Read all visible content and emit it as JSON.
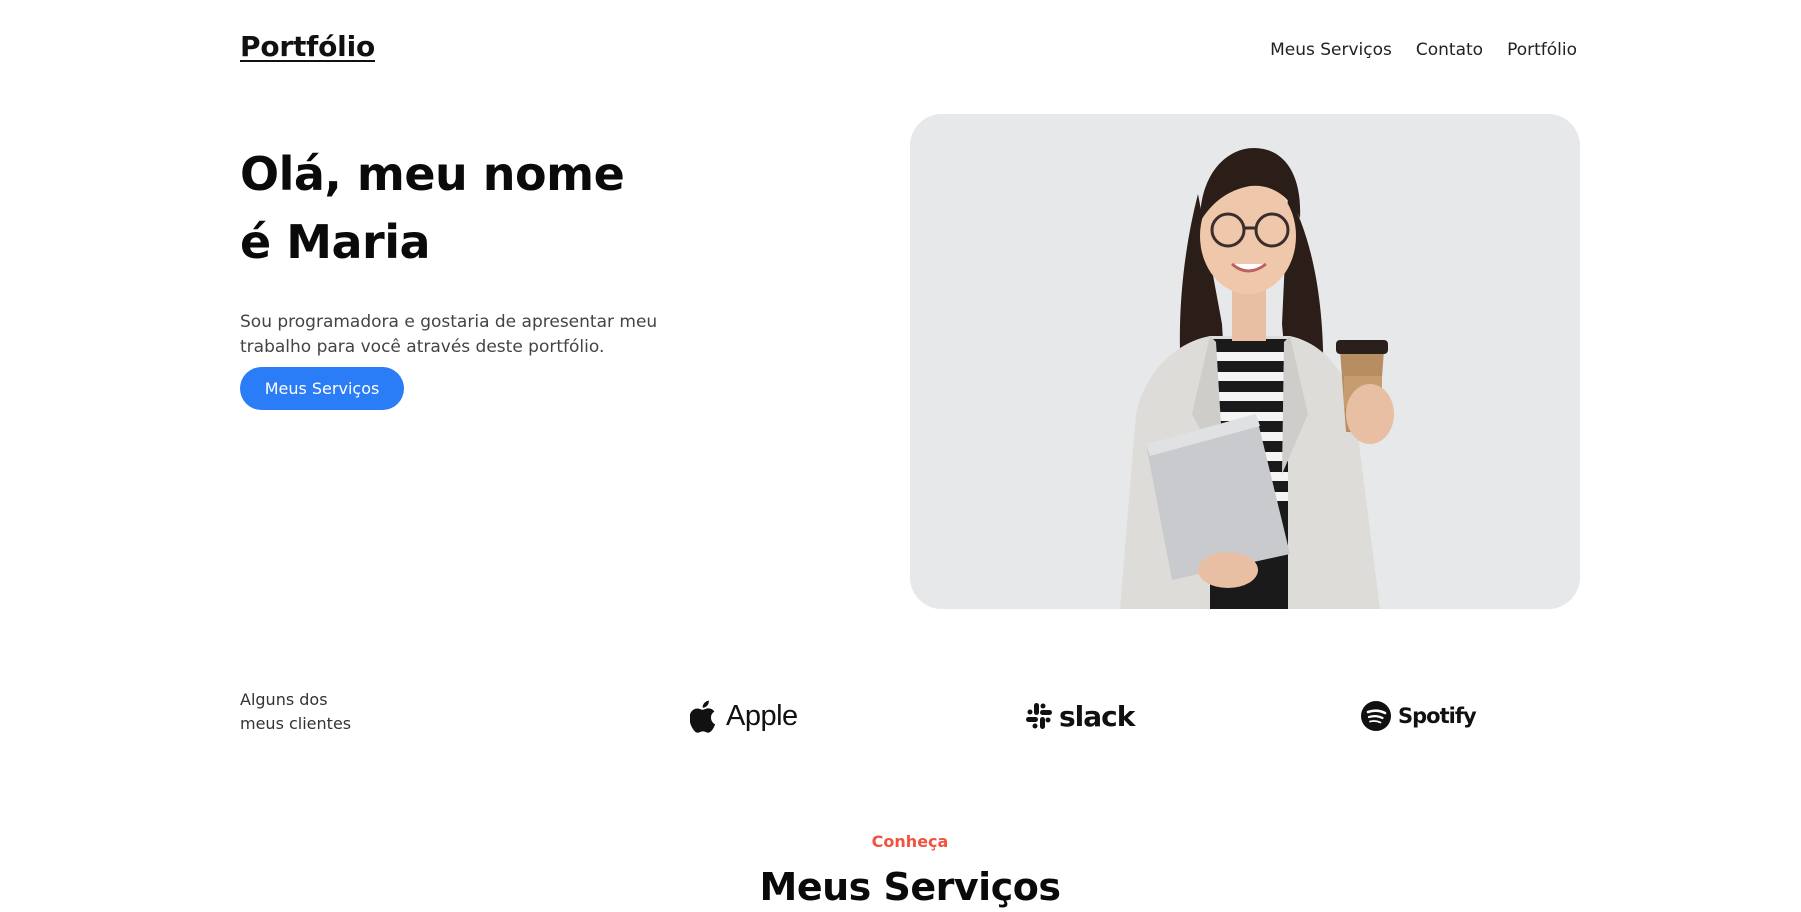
{
  "header": {
    "logo": "Portfólio",
    "nav": [
      "Meus Serviços",
      "Contato",
      "Portfólio"
    ]
  },
  "hero": {
    "title_line1": "Olá, meu nome",
    "title_line2": "é Maria",
    "description": "Sou programadora e gostaria de apresentar meu trabalho para você através deste portfólio.",
    "cta": "Meus Serviços",
    "photo_icon": "woman-with-laptop-and-coffee-photo"
  },
  "clients": {
    "label_line1": "Alguns dos",
    "label_line2": "meus clientes",
    "brands": [
      {
        "name": "Apple",
        "icon": "apple-logo-icon"
      },
      {
        "name": "slack",
        "icon": "slack-logo-icon"
      },
      {
        "name": "Spotify",
        "icon": "spotify-logo-icon"
      }
    ]
  },
  "services_section": {
    "kicker": "Conheça",
    "title": "Meus Serviços"
  },
  "colors": {
    "accent": "#2a7cf7",
    "kicker": "#f0533f",
    "photo_bg": "#e7e8ea"
  }
}
